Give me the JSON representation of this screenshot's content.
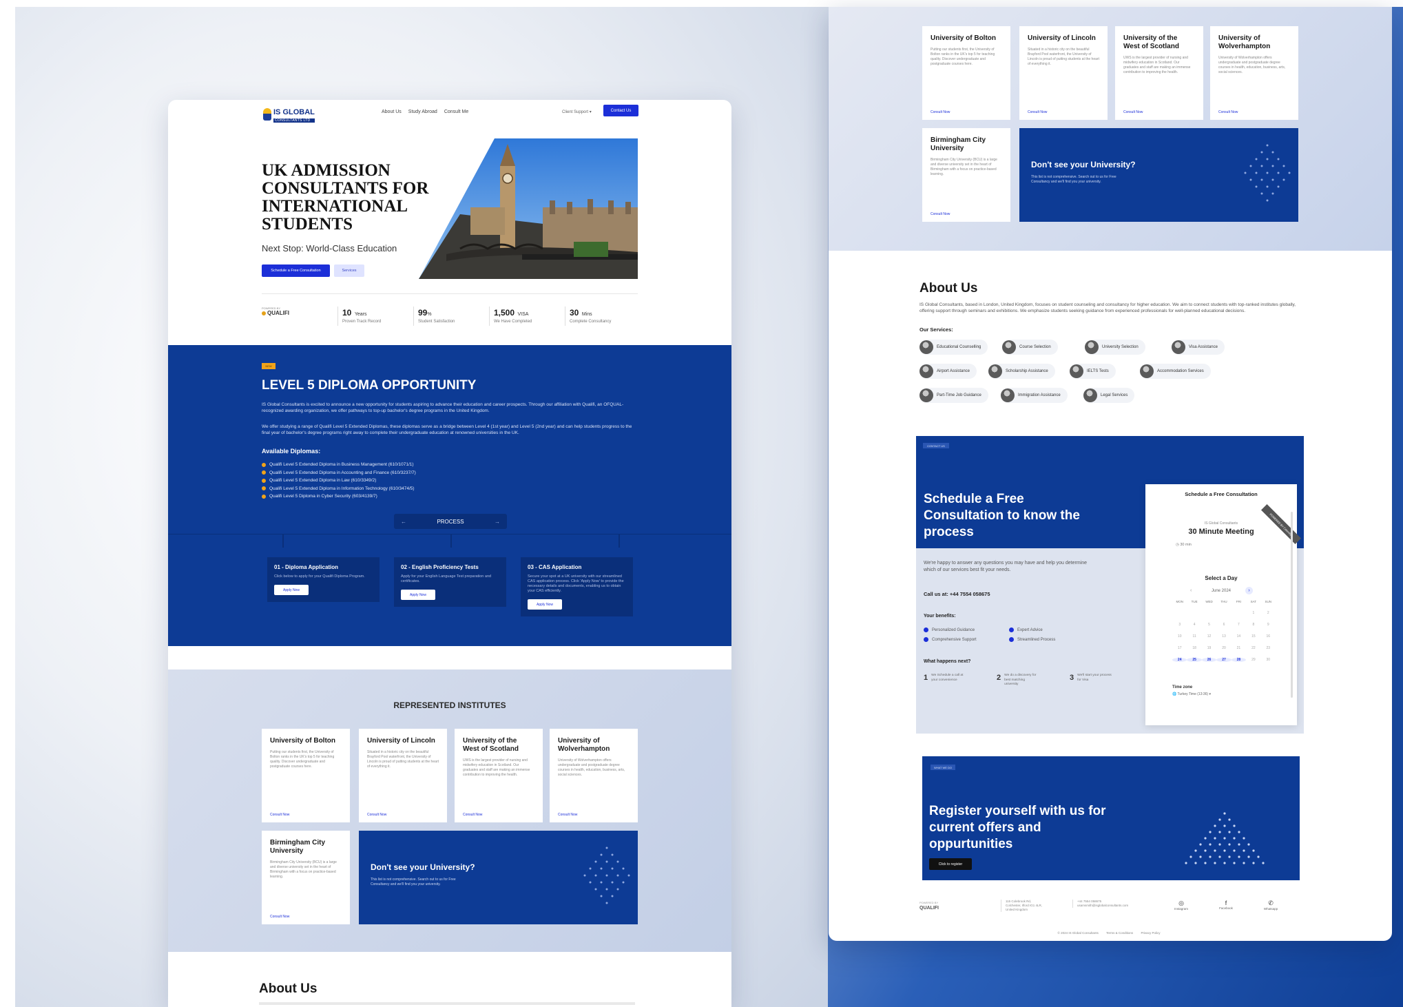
{
  "nav": {
    "logo_text": "IS GLOBAL",
    "logo_sub": "CONSULTANTS LTD",
    "links": [
      "About Us",
      "Study Abroad",
      "Consult Me"
    ],
    "client_support": "Client Support",
    "contact_label": "Contact Us"
  },
  "hero": {
    "title": "UK ADMISSION CONSULTANTS FOR INTERNATIONAL STUDENTS",
    "subtitle": "Next Stop: World-Class Education",
    "primary_button": "Schedule a Free Consultation",
    "secondary_button": "Services"
  },
  "stats": {
    "powered_by": "POWERED BY",
    "partner": "QUALIFI",
    "items": [
      {
        "num": "10",
        "unit": "Years",
        "label": "Proven Track Record"
      },
      {
        "num": "99",
        "unit": "%",
        "label": "Student Satisfaction"
      },
      {
        "num": "1,500",
        "unit": "VISA",
        "label": "We Have Completed"
      },
      {
        "num": "30",
        "unit": "Mins",
        "label": "Complete Consultancy"
      }
    ]
  },
  "diploma": {
    "tag": "NEW",
    "title": "LEVEL 5 DIPLOMA OPPORTUNITY",
    "p1": "IS Global Consultants is excited to announce a new opportunity for students aspiring to advance their education and career prospects. Through our affiliation with Qualifi, an OFQUAL-recognized awarding organization, we offer pathways to top-up bachelor's degree programs in the United Kingdom.",
    "p2": "We offer studying a range of Qualifi Level 5 Extended Diplomas, these diplomas serve as a bridge between Level 4 (1st year) and Level 5 (2nd year) and can help students progress to the final year of bachelor's degree programs right away to complete their undergraduate education at renowned universities in the UK.",
    "available_label": "Available Diplomas:",
    "list": [
      "Qualifi Level 5 Extended Diploma in Business Management (610/1071/1)",
      "Qualifi Level 5 Extended Diploma in Accounting and Finance (610/3237/7)",
      "Qualifi Level 5 Extended Diploma in Law (610/3349/2)",
      "Qualifi Level 5 Extended Diploma in Information Technology (610/3474/5)",
      "Qualifi Level 5 Diploma in Cyber Security (603/4139/7)"
    ],
    "process_label": "PROCESS",
    "steps": [
      {
        "title": "01 - Diploma Application",
        "desc": "Click below to apply for your Qualifi Diploma Program.",
        "button": "Apply Now"
      },
      {
        "title": "02 - English Proficiency Tests",
        "desc": "Apply for your English Language Test preparation and certificates.",
        "button": "Apply Now"
      },
      {
        "title": "03 - CAS Application",
        "desc": "Secure your spot at a UK university with our streamlined CAS application process. Click 'Apply Now' to provide the necessary details and documents, enabling us to obtain your CAS efficiently.",
        "button": "Apply Now"
      }
    ]
  },
  "institutes": {
    "title": "REPRESENTED INSTITUTES",
    "consult_label": "Consult Now",
    "cards": [
      {
        "name": "University of Bolton",
        "desc": "Putting our students first, the University of Bolton ranks in the UK's top 5 for teaching quality. Discover undergraduate and postgraduate courses here."
      },
      {
        "name": "University of Lincoln",
        "desc": "Situated in a historic city on the beautiful Brayford Pool waterfront, the University of Lincoln is proud of putting students at the heart of everything it."
      },
      {
        "name": "University of the West of Scotland",
        "desc": "UWS is the largest provider of nursing and midwifery education in Scotland. Our graduates and staff are making an immense contribution to improving the health."
      },
      {
        "name": "University of Wolverhampton",
        "desc": "University of Wolverhampton offers undergraduate and postgraduate degree courses in health, education, business, arts, social sciences."
      },
      {
        "name": "Birmingham City University",
        "desc": "Birmingham City University (BCU) is a large and diverse university set in the heart of Birmingham with a focus on practice-based learning."
      }
    ],
    "dont_title": "Don't see your University?",
    "dont_desc": "This list is not comprehensive. Search out to us for Free Consultancy and we'll find you your university."
  },
  "about": {
    "title": "About Us",
    "desc": "IS Global Consultants, based in London, United Kingdom, focuses on student counseling and consultancy for higher education. We aim to connect students with top-ranked institutes globally, offering support through seminars and exhibitions. We emphasize students seeking guidance from experienced professionals for well-planned educational decisions.",
    "services_label": "Our Services:",
    "services": [
      "Educational Counselling",
      "Course Selection",
      "University Selection",
      "Visa Assistance",
      "Airport Assistance",
      "Scholarship Assistance",
      "IELTS Tests",
      "Accommodation Services",
      "Part-Time Job Guidance",
      "Immigration Assistance",
      "Legal Services"
    ]
  },
  "schedule": {
    "tag": "CONTACT US",
    "title": "Schedule a Free Consultation to know the process",
    "desc": "We're happy to answer any questions you may have and help you determine which of our services best fit your needs.",
    "call": "Call us at: +44 7554 058675",
    "benefits_label": "Your benefits:",
    "benefits": [
      "Personalized Guidance",
      "Expert Advice",
      "Comprehensive Support",
      "Streamlined Process"
    ],
    "next_label": "What happens next?",
    "next_steps": [
      {
        "n": "1",
        "t": "We Schedule a call at your convenience"
      },
      {
        "n": "2",
        "t": "We do a discovery for best matching university"
      },
      {
        "n": "3",
        "t": "We'll start your process for Visa"
      }
    ],
    "calendar": {
      "header": "Schedule a Free Consultation",
      "org": "IS Global Consultants",
      "meeting": "30 Minute Meeting",
      "duration": "30 min",
      "ribbon": "POWERED BY Calendly",
      "select_day": "Select a Day",
      "month": "June 2024",
      "dows": [
        "MON",
        "TUE",
        "WED",
        "THU",
        "FRI",
        "SAT",
        "SUN"
      ],
      "timezone_label": "Time zone",
      "timezone_value": "Turkey Time (13:36)"
    }
  },
  "register": {
    "tag": "WHAT WE DO",
    "title": "Register yourself with us for current offers and oppurtunities",
    "button": "Click to register"
  },
  "footer": {
    "powered_by": "POWERED BY",
    "partner": "QUALIFI",
    "address": "115 Colebrook Rd, Colchester, Ilford IG1 4LR, United Kingdom",
    "contact": "+44 7554 058675 usamsmith@isglobalconsultants.com",
    "socials": [
      {
        "icon": "instagram-icon",
        "glyph": "◎",
        "name": "Instagram"
      },
      {
        "icon": "facebook-icon",
        "glyph": "f",
        "name": "Facebook"
      },
      {
        "icon": "whatsapp-icon",
        "glyph": "✆",
        "name": "Whatsapp"
      }
    ],
    "copyright": "© 2024 IS Global Consultants",
    "terms": "Terms & Conditions",
    "privacy": "Privacy Policy"
  },
  "colors": {
    "brand_blue": "#0d3b95",
    "accent_blue": "#1c2fd8",
    "accent_orange": "#f0a31a"
  }
}
